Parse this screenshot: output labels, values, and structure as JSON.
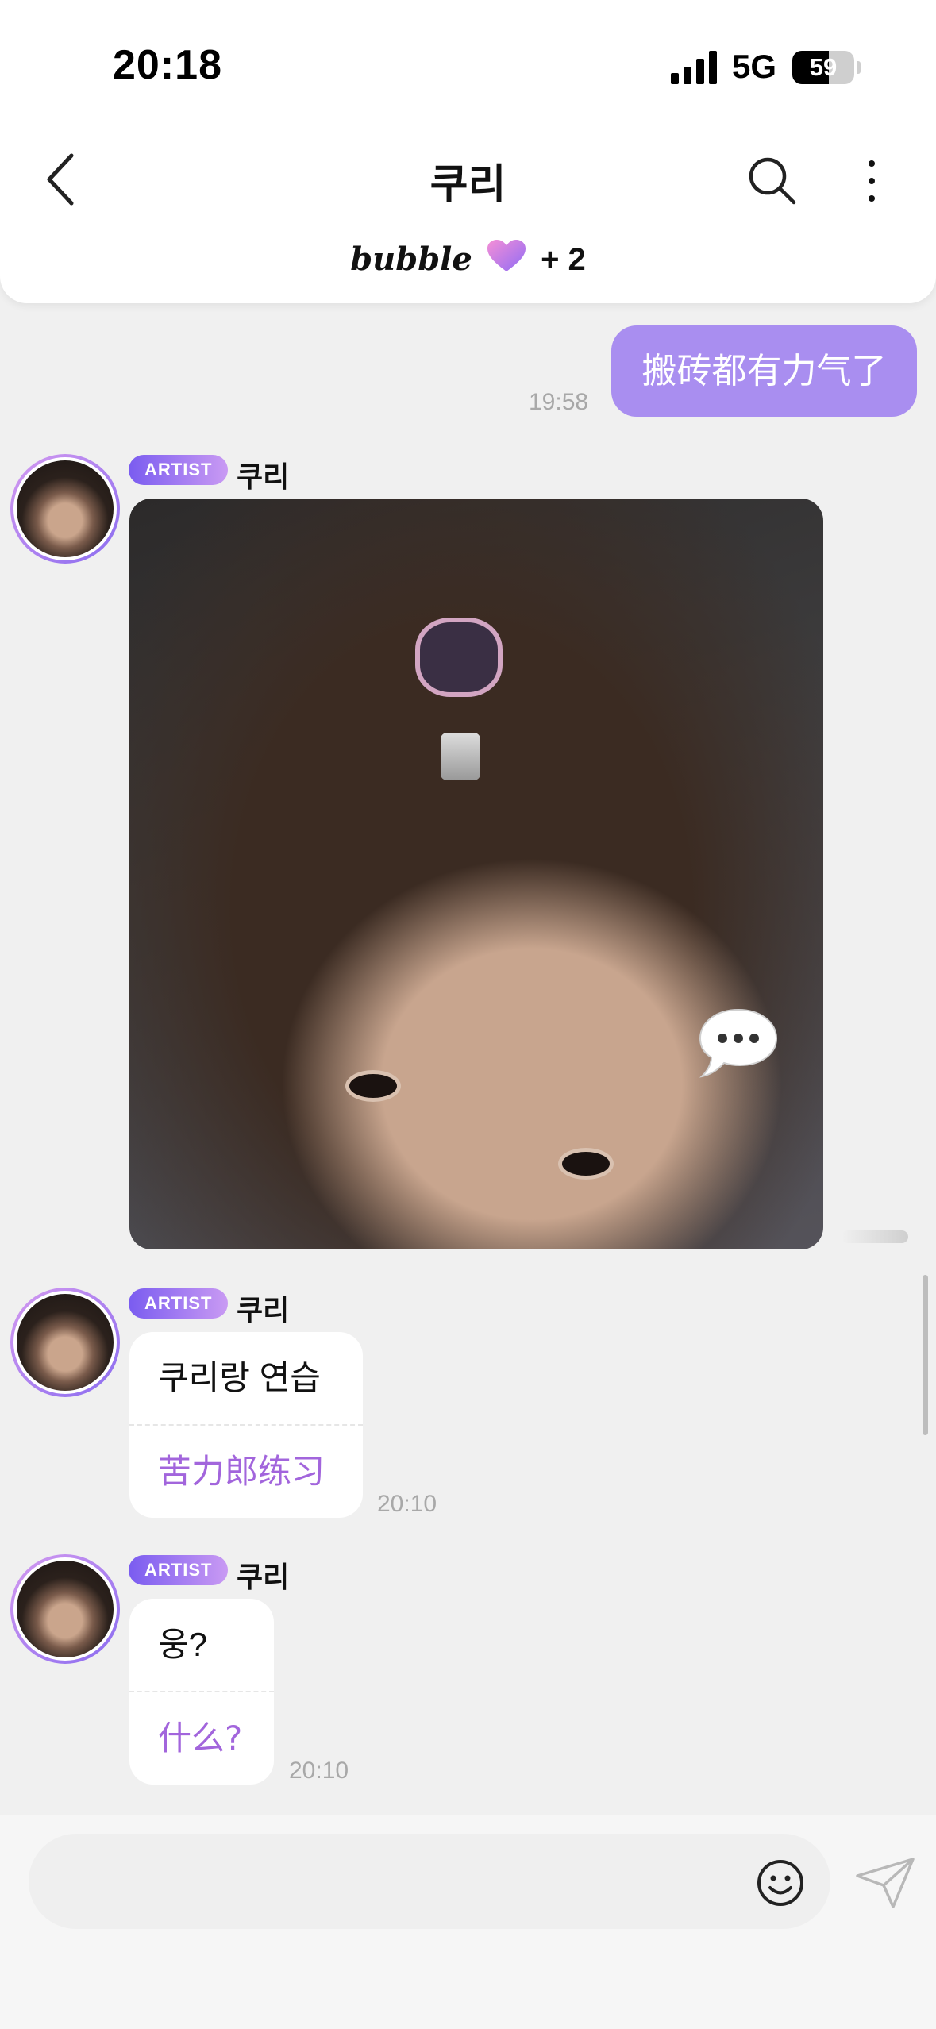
{
  "status_bar": {
    "time": "20:18",
    "network": "5G",
    "battery": "59",
    "battery_level": 0.59
  },
  "header": {
    "title": "쿠리",
    "bubble_logo": "bubble",
    "bubble_count": "+ 2"
  },
  "messages": {
    "sent": {
      "text": "搬砖都有力气了",
      "time": "19:58"
    },
    "photo_post": {
      "badge": "ARTIST",
      "name": "쿠리"
    },
    "text_post_1": {
      "badge": "ARTIST",
      "name": "쿠리",
      "original": "쿠리랑 연습",
      "translation": "苦力郎练习",
      "time": "20:10"
    },
    "text_post_2": {
      "badge": "ARTIST",
      "name": "쿠리",
      "original": "웅?",
      "translation": "什么?",
      "time": "20:10"
    }
  },
  "input": {
    "placeholder": ""
  },
  "colors": {
    "accent": "#a98ef0",
    "translation": "#a265dc",
    "badge_start": "#7a5cf0",
    "badge_end": "#c99af3"
  },
  "icons": [
    "back-chevron-icon",
    "search-icon",
    "more-vertical-icon",
    "heart-icon",
    "speech-bubble-icon",
    "emoji-icon",
    "send-icon"
  ]
}
